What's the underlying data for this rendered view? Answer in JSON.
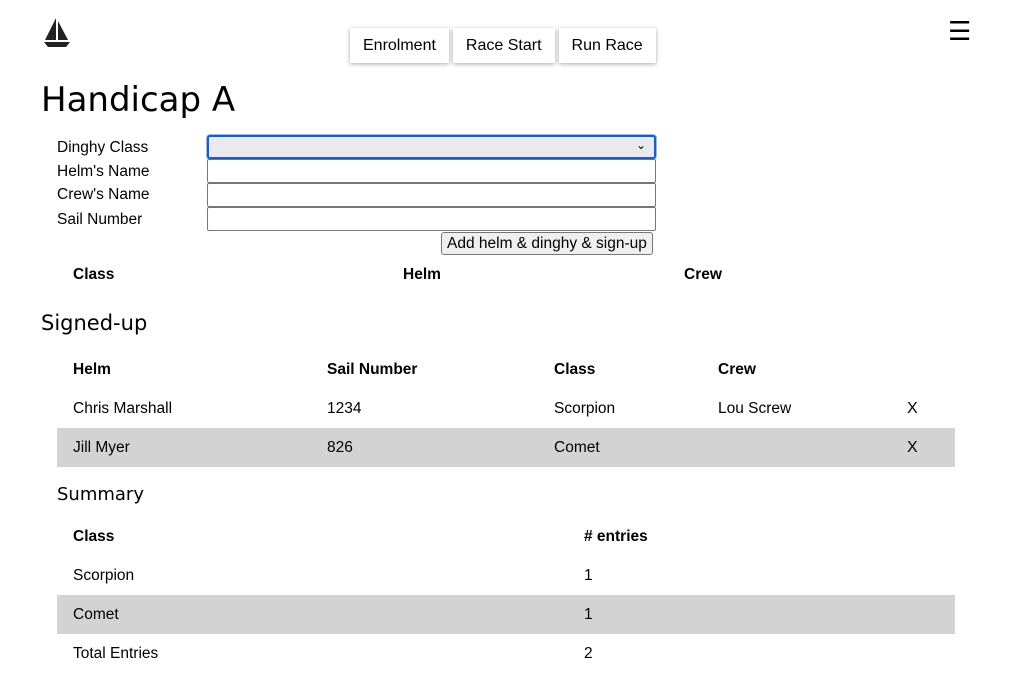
{
  "nav": {
    "buttons": [
      "Enrolment",
      "Race Start",
      "Run Race"
    ],
    "menu_icon": "hamburger-menu-icon",
    "logo_icon": "sailboat-icon"
  },
  "page": {
    "title": "Handicap A"
  },
  "form": {
    "dinghy_class_label": "Dinghy Class",
    "dinghy_class_value": "",
    "helm_label": "Helm's Name",
    "helm_value": "",
    "crew_label": "Crew's Name",
    "crew_value": "",
    "sail_label": "Sail Number",
    "sail_value": "",
    "add_button": "Add helm & dinghy & sign-up"
  },
  "helm_table": {
    "headers": [
      "Class",
      "Helm",
      "Crew"
    ]
  },
  "signed_up": {
    "heading": "Signed-up",
    "headers": [
      "Helm",
      "Sail Number",
      "Class",
      "Crew"
    ],
    "remove_label": "X",
    "rows": [
      {
        "helm": "Chris Marshall",
        "sail_number": "1234",
        "class": "Scorpion",
        "crew": "Lou Screw"
      },
      {
        "helm": "Jill Myer",
        "sail_number": "826",
        "class": "Comet",
        "crew": ""
      }
    ]
  },
  "summary": {
    "heading": "Summary",
    "headers": [
      "Class",
      "# entries"
    ],
    "rows": [
      {
        "class": "Scorpion",
        "entries": "1"
      },
      {
        "class": "Comet",
        "entries": "1"
      }
    ],
    "total_label": "Total Entries",
    "total_value": "2"
  },
  "colors": {
    "row_shade": "#d3d3d3",
    "select_focus": "#1a5fbf"
  }
}
